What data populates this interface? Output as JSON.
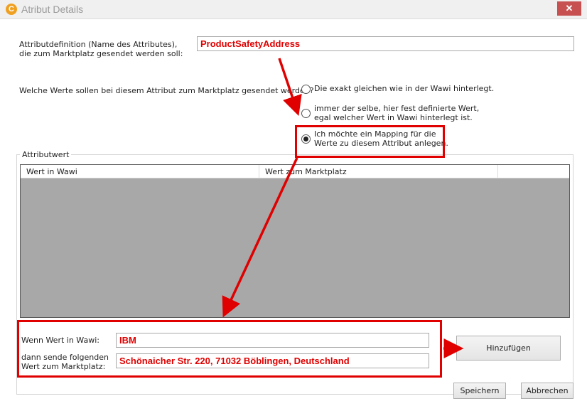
{
  "window": {
    "title": "Atribut Details",
    "close_glyph": "✕",
    "app_icon": "jtl-logo-icon",
    "app_icon_glyph": "C"
  },
  "definition": {
    "label_line1": "Attributdefinition (Name des Attributes),",
    "label_line2": "die zum Marktplatz gesendet werden soll:",
    "value": "ProductSafetyAddress"
  },
  "question": {
    "label": "Welche Werte sollen bei diesem Attribut zum Marktplatz gesendet werden?",
    "options": [
      {
        "line1": "Die exakt gleichen wie in der Wawi hinterlegt.",
        "line2": "",
        "checked": false
      },
      {
        "line1": "immer der selbe, hier fest definierte Wert,",
        "line2": "egal welcher Wert in Wawi hinterlegt ist.",
        "checked": false
      },
      {
        "line1": "Ich möchte ein Mapping für die",
        "line2": "Werte zu diesem Attribut anlegen.",
        "checked": true
      }
    ]
  },
  "attributwert": {
    "legend": "Attributwert",
    "columns": [
      "Wert in Wawi",
      "Wert zum Marktplatz",
      ""
    ],
    "rows": []
  },
  "mapping": {
    "wawi_label": "Wenn Wert in Wawi:",
    "wawi_value": "IBM",
    "send_label_line1": "dann sende folgenden",
    "send_label_line2": "Wert zum Marktplatz:",
    "send_value": "Schönaicher Str. 220, 71032 Böblingen, Deutschland",
    "add_button": "Hinzufügen"
  },
  "footer": {
    "save_button": "Speichern",
    "cancel_button": "Abbrechen"
  },
  "colors": {
    "highlight": "#e00000",
    "grid_background": "#a8a8a8",
    "close_button": "#c75050"
  }
}
